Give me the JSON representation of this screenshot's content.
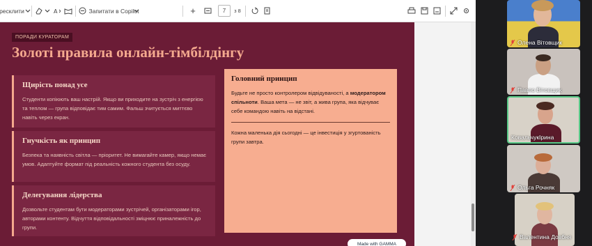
{
  "toolbar": {
    "translate_label": "ресклити",
    "copilot_label": "Запитати в Copilot",
    "page_current": "7",
    "page_total": "з 8"
  },
  "slide": {
    "badge": "ПОРАДИ КУРАТОРАМ",
    "title": "Золоті правила онлайн-тімбілдінгу",
    "cards": [
      {
        "heading": "Щирість понад усе",
        "text": "Студенти копіюють ваш настрій. Якщо ви приходите на зустріч з енергією та теплом — група відповідає тим самим. Фальш зчитується миттєво навіть через екран."
      },
      {
        "heading": "Гнучкість як принцип",
        "text": "Безпека та наявність світла — пріоритет. Не вимагайте камер, якщо немає умов. Адаптуйте формат під реальність кожного студента без осуду."
      },
      {
        "heading": "Делегування лідерства",
        "text": "Дозвольте студентам бути модераторами зустрічей, організаторами ігор, авторами контенту. Відчуття відповідальності зміцнює приналежність до групи."
      }
    ],
    "principle": {
      "heading": "Головний принцип",
      "text_before": "Будьте не просто контролером відвідуваності, а",
      "text_bold": "модератором спільноти",
      "text_after": ". Ваша мета — не звіт, а жива група, яка відчуває себе командою навіть на відстані.",
      "footer": "Кожна маленька дія сьогодні — це інвестиція у згуртованість групи завтра."
    },
    "made_with": "Made with GAMMA"
  },
  "call": {
    "participants": [
      {
        "name": "Олена Вітовщик",
        "muted": true
      },
      {
        "name": "Павло Вітовщик",
        "muted": true
      },
      {
        "name": "КовальчукІрина",
        "muted": false,
        "active": true
      },
      {
        "name": "Ольга Рочняк",
        "muted": true
      },
      {
        "name": "Валентина Довбня",
        "muted": true
      }
    ]
  },
  "colors": {
    "slide_bg": "#6b1c36",
    "accent": "#f4a98e",
    "card_bg": "#7a2642",
    "panel_bg": "#f7ad90",
    "active_speaker": "#58c987",
    "muted_icon": "#e0413a"
  }
}
